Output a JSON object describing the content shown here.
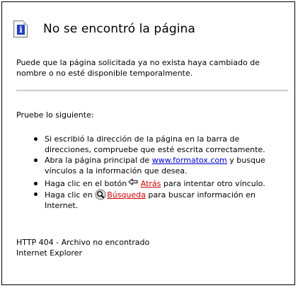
{
  "page": {
    "title": "No se encontró la página",
    "icon": "info-icon",
    "intro": "Puede que la página solicitada ya no exista haya cambiado de nombre o no esté disponible temporalmente.",
    "try_label": "Pruebe lo siguiente:"
  },
  "tips": {
    "address": "Si escribió la dirección de la página en la barra de direcciones, compruebe que esté escrita correctamente.",
    "home_prefix": "Abra la página principal de",
    "home_link": "www.formatox.com",
    "home_suffix": "y busque vínculos a la información que desea.",
    "back_prefix": "Haga clic en el botón",
    "back_link": "Atrás",
    "back_suffix": "para intentar otro vínculo.",
    "search_prefix": "Haga clic en",
    "search_link": "Búsqueda",
    "search_suffix": "para buscar información en Internet."
  },
  "footer": {
    "status": "HTTP 404 - Archivo no encontrado",
    "browser": "Internet Explorer"
  },
  "colors": {
    "link": "#0000cc",
    "search_link": "#cc0000",
    "icon_blue": "#1f3fbf"
  }
}
